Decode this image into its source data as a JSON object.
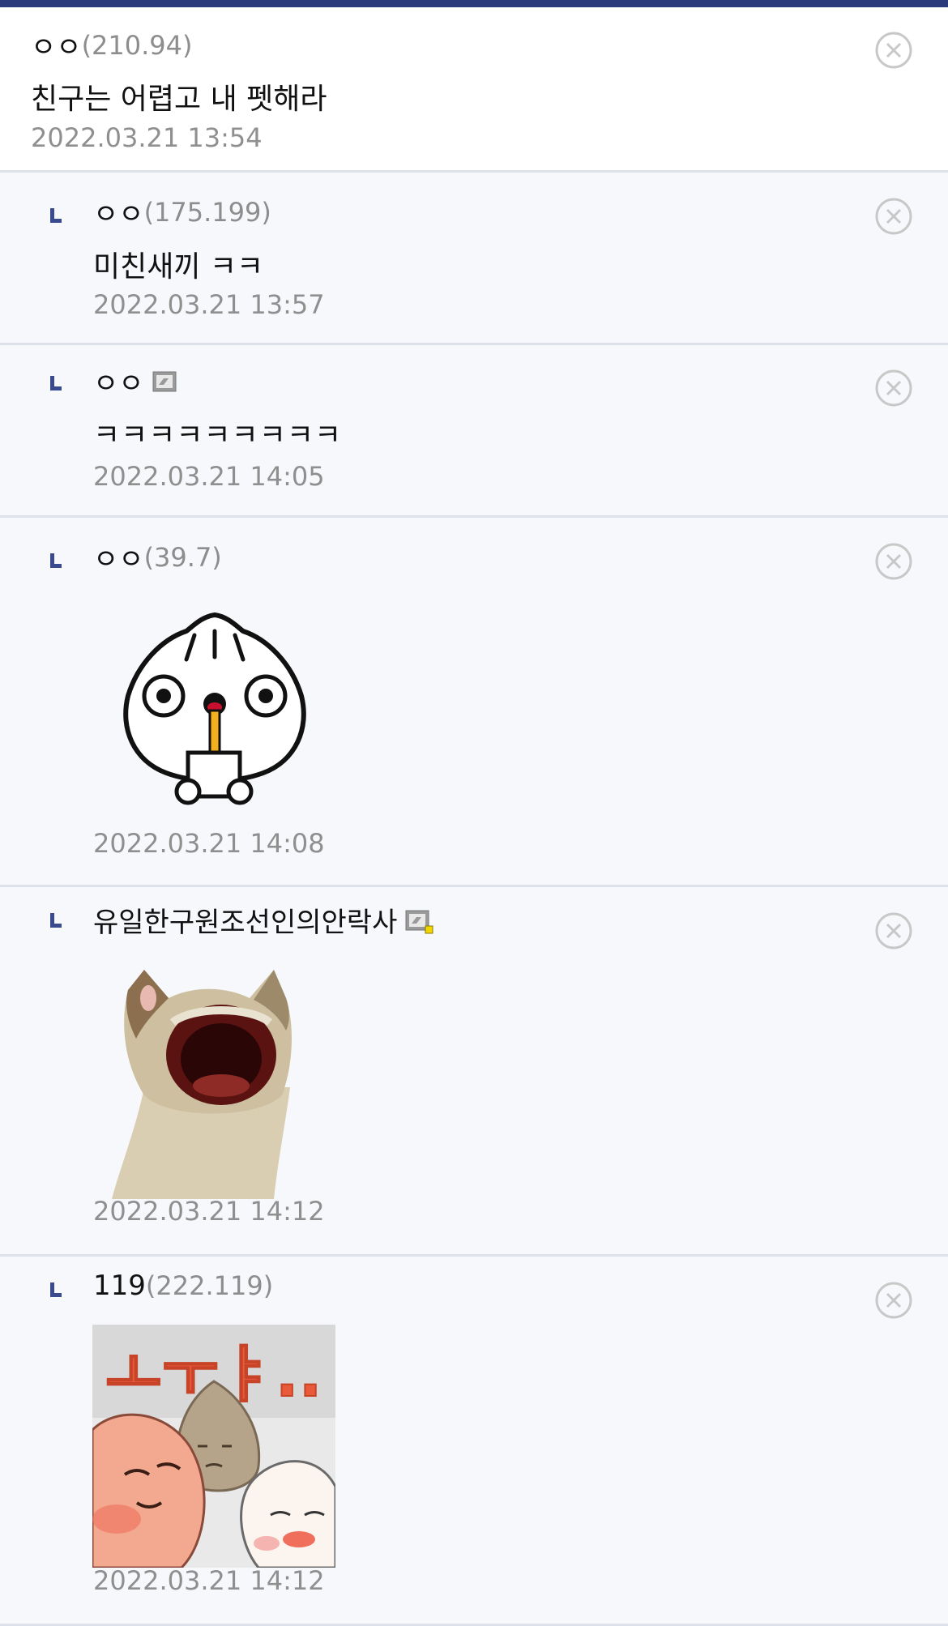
{
  "comments": [
    {
      "nick": "ㅇㅇ",
      "ip": "(210.94)",
      "text": "친구는 어렵고 내 펫해라",
      "date": "2022.03.21 13:54",
      "is_reply": false
    },
    {
      "nick": "ㅇㅇ",
      "ip": "(175.199)",
      "text": "미친새끼 ㅋㅋ",
      "date": "2022.03.21 13:57",
      "is_reply": true
    },
    {
      "nick": "ㅇㅇ",
      "ip": "",
      "badge": "fixed-nick-badge-icon",
      "text": "ㅋㅋㅋㅋㅋㅋㅋㅋㅋ",
      "date": "2022.03.21 14:05",
      "is_reply": true
    },
    {
      "nick": "ㅇㅇ",
      "ip": "(39.7)",
      "sticker": "dumpling-drinking-sticker",
      "date": "2022.03.21 14:08",
      "is_reply": true
    },
    {
      "nick": "유일한구원조선인의안락사",
      "ip": "",
      "badge": "fixed-nick-badge-yellow-icon",
      "sticker": "screaming-cat-sticker",
      "date": "2022.03.21 14:12",
      "is_reply": true
    },
    {
      "nick": "119",
      "ip": "(222.119)",
      "sticker": "dumplings-laughing-sticker",
      "sticker_text": "ㅗㅜㅑ..",
      "date": "2022.03.21 14:12",
      "is_reply": true
    }
  ],
  "colors": {
    "accent": "#2b3a7a",
    "reply_mark": "#3a4a8f",
    "ip_text": "#8d8d8d",
    "date_text": "#8f8f8f",
    "divider": "#dde1ea",
    "reply_bg": "#f7f8fb"
  }
}
